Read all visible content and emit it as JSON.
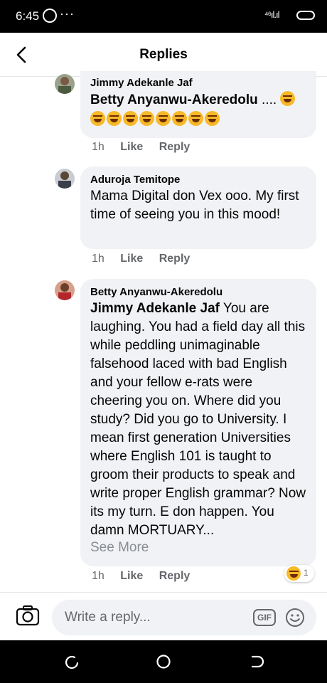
{
  "status_bar": {
    "time": "6:45",
    "more": "···",
    "signal": "⁴⁶ıl.ıl"
  },
  "header": {
    "title": "Replies"
  },
  "comments": [
    {
      "author": "Jimmy Adekanle Jaf",
      "mention": "Betty Anyanwu-Akeredolu",
      "text": " ....",
      "time": "1h",
      "like": "Like",
      "reply": "Reply"
    },
    {
      "author": "Aduroja Temitope",
      "text": "Mama Digital don Vex ooo. My first time of seeing you in this mood!",
      "time": "1h",
      "like": "Like",
      "reply": "Reply"
    },
    {
      "author": "Betty Anyanwu-Akeredolu",
      "mention": "Jimmy Adekanle Jaf",
      "text": " You are laughing. You had a field day all this while peddling unimaginable falsehood laced with bad English and your fellow e-rats were cheering you on. Where did you study? Did you go to University. I mean first generation Universities where English 101 is taught to groom their products to speak and write proper English grammar? Now its my turn. E don happen. You damn MORTUARY...",
      "see_more": "See More",
      "time": "1h",
      "like": "Like",
      "reply": "Reply",
      "reaction_count": "1"
    }
  ],
  "composer": {
    "placeholder": "Write a reply...",
    "gif_label": "GIF"
  },
  "colors": {
    "bubble": "#f0f2f5",
    "meta": "#65676b",
    "emoji": "#f7b928"
  }
}
